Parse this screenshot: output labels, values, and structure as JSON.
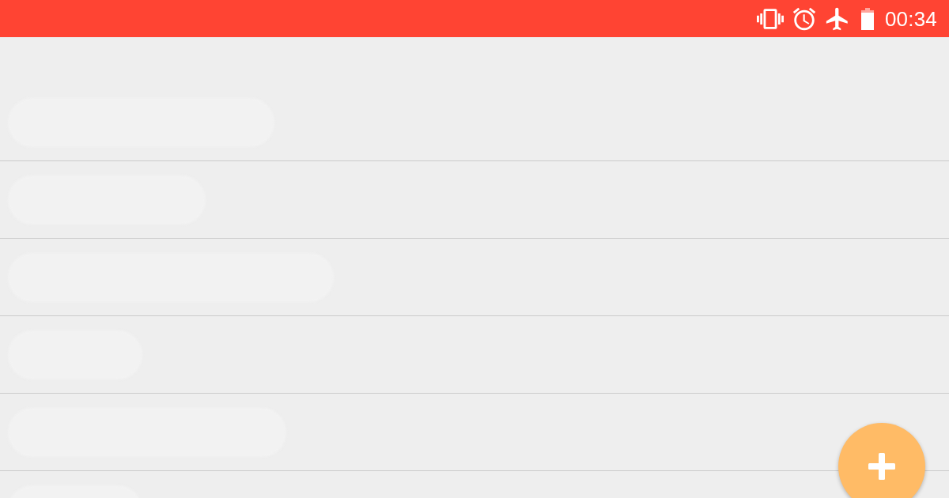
{
  "status_bar": {
    "time": "00:34"
  },
  "list": {
    "rows": [
      {
        "redacted": true
      },
      {
        "redacted": true
      },
      {
        "redacted": true
      },
      {
        "redacted": true
      },
      {
        "redacted": true
      },
      {
        "redacted": true
      }
    ]
  }
}
